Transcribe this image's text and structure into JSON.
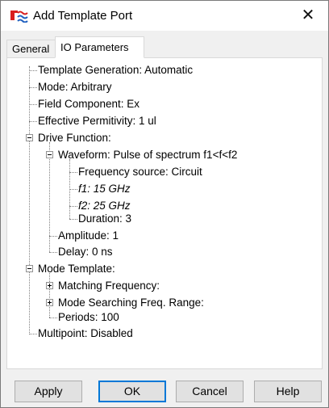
{
  "window": {
    "title": "Add Template Port",
    "close_glyph": "✕"
  },
  "tabs": [
    {
      "label": "General",
      "selected": false
    },
    {
      "label": "IO Parameters",
      "selected": true
    }
  ],
  "tree": {
    "template_generation": "Template Generation: Automatic",
    "mode": "Mode: Arbitrary",
    "field_component": "Field Component: Ex",
    "effective_permitivity": "Effective Permitivity: 1 ul",
    "drive_function": "Drive Function:",
    "waveform": "Waveform: Pulse of spectrum f1<f<f2",
    "frequency_source": "Frequency source: Circuit",
    "f1": "f1: 15 GHz",
    "f2": "f2: 25 GHz",
    "duration": "Duration: 3",
    "amplitude": "Amplitude: 1",
    "delay": "Delay: 0 ns",
    "mode_template": "Mode Template:",
    "matching_frequency": "Matching Frequency:",
    "mode_searching_range": "Mode Searching Freq. Range:",
    "periods": "Periods: 100",
    "multipoint": "Multipoint: Disabled"
  },
  "buttons": {
    "apply": "Apply",
    "ok": "OK",
    "cancel": "Cancel",
    "help": "Help"
  },
  "colors": {
    "accent": "#0078d7",
    "app_icon_red": "#d81e1e",
    "app_icon_blue": "#1f5fbf"
  },
  "icons": {
    "app": "app-logo-icon",
    "close": "close-icon",
    "expand": "plus-box-icon",
    "collapse": "minus-box-icon"
  }
}
